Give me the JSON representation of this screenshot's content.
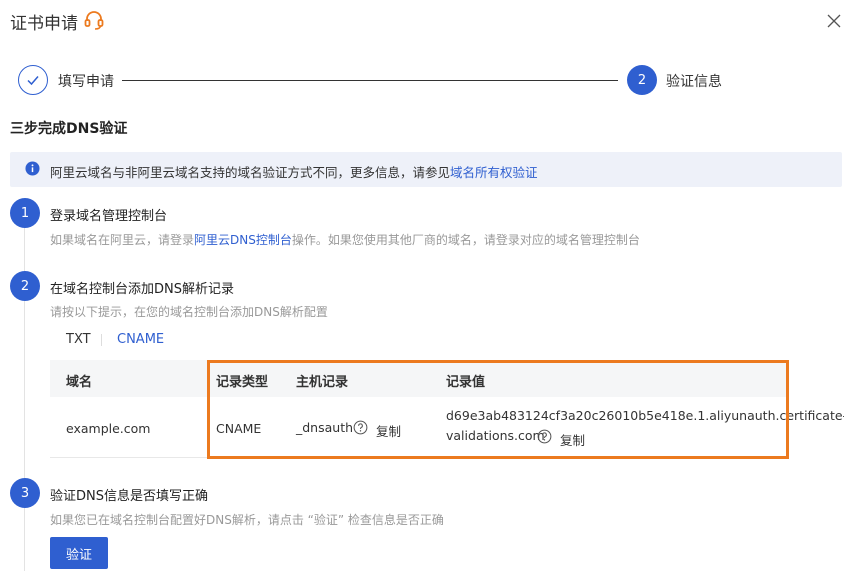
{
  "header": {
    "title": "证书申请",
    "close_icon": "close-icon",
    "support_icon": "headset-icon"
  },
  "steps_nav": {
    "step1_label": "填写申请",
    "step2_number": "2",
    "step2_label": "验证信息"
  },
  "section_title": "三步完成DNS验证",
  "banner": {
    "text": "阿里云域名与非阿里云域名支持的域名验证方式不同，更多信息，请参见",
    "link": "域名所有权验证"
  },
  "step1": {
    "number": "1",
    "title": "登录域名管理控制台",
    "desc_prefix": "如果域名在阿里云，请登录",
    "desc_link": "阿里云DNS控制台",
    "desc_suffix": "操作。如果您使用其他厂商的域名，请登录对应的域名管理控制台"
  },
  "step2": {
    "number": "2",
    "title": "在域名控制台添加DNS解析记录",
    "desc": "请按以下提示，在您的域名控制台添加DNS解析配置",
    "tabs": [
      "TXT",
      "CNAME"
    ],
    "active_tab": "CNAME",
    "table": {
      "headers": [
        "域名",
        "记录类型",
        "主机记录",
        "记录值"
      ],
      "row": {
        "domain": "example.com",
        "type": "CNAME",
        "host": "_dnsauth",
        "value_line1": "d69e3ab483124cf3a20c26010b5e418e.1.aliyunauth.certificate-",
        "value_line2": "validations.com",
        "copy_label": "复制"
      }
    }
  },
  "step3": {
    "number": "3",
    "title": "验证DNS信息是否填写正确",
    "desc": "如果您已在域名控制台配置好DNS解析，请点击 “验证” 检查信息是否正确",
    "button": "验证"
  },
  "colors": {
    "primary": "#2f5fd0",
    "highlight": "#ec7a1f",
    "banner_bg": "#eef1f9"
  }
}
